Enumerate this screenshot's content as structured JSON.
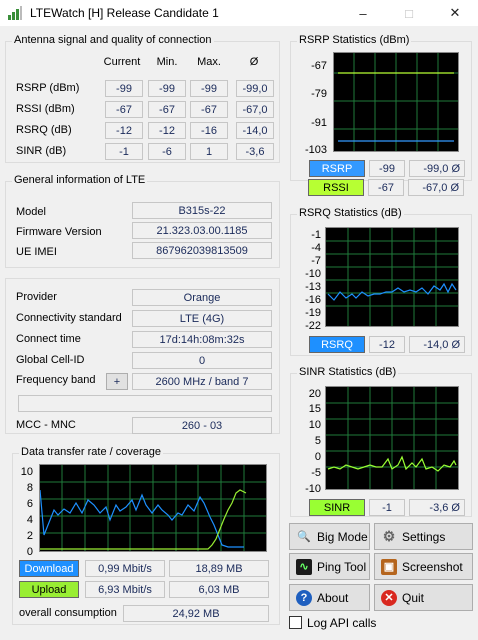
{
  "window": {
    "title": "LTEWatch [H]   Release Candidate 1"
  },
  "antenna": {
    "title": "Antenna signal and quality of connection",
    "headers": [
      "Current",
      "Min.",
      "Max.",
      "Ø"
    ],
    "rows": [
      {
        "label": "RSRP (dBm)",
        "values": [
          "-99",
          "-99",
          "-99",
          "-99,0"
        ]
      },
      {
        "label": "RSSI (dBm)",
        "values": [
          "-67",
          "-67",
          "-67",
          "-67,0"
        ]
      },
      {
        "label": "RSRQ (dB)",
        "values": [
          "-12",
          "-12",
          "-16",
          "-14,0"
        ]
      },
      {
        "label": "SINR (dB)",
        "values": [
          "-1",
          "-6",
          "1",
          "-3,6"
        ]
      }
    ]
  },
  "general": {
    "title": "General information of LTE",
    "model_label": "Model",
    "model": "B315s-22",
    "firmware_label": "Firmware Version",
    "firmware": "21.323.03.00.1185",
    "imei_label": "UE IMEI",
    "imei": "867962039813509"
  },
  "provider": {
    "provider_label": "Provider",
    "provider": "Orange",
    "standard_label": "Connectivity standard",
    "standard": "LTE (4G)",
    "connect_label": "Connect time",
    "connect": "17d:14h:08m:32s",
    "cell_label": "Global Cell-ID",
    "cell": "0",
    "band_label": "Frequency band",
    "band_button": "+",
    "band": "2600 MHz / band 7",
    "extra": "",
    "mccmnc_label": "MCC - MNC",
    "mccmnc": "260 - 03"
  },
  "transfer": {
    "title": "Data transfer rate / coverage",
    "yticks": [
      "10",
      "8",
      "6",
      "4",
      "2",
      "0"
    ],
    "download_label": "Download",
    "download_rate": "0,99 Mbit/s",
    "download_total": "18,89 MB",
    "upload_label": "Upload",
    "upload_rate": "6,93 Mbit/s",
    "upload_total": "6,03 MB",
    "overall_label": "overall consumption",
    "overall": "24,92 MB"
  },
  "rsrp_stats": {
    "title": "RSRP Statistics (dBm)",
    "yticks": [
      "-67",
      "-79",
      "-91",
      "-103"
    ],
    "legend1": "RSRP",
    "cur1": "-99",
    "avg1": "-99,0 Ø",
    "legend2": "RSSI",
    "cur2": "-67",
    "avg2": "-67,0 Ø"
  },
  "rsrq_stats": {
    "title": "RSRQ Statistics (dB)",
    "yticks": [
      "-1",
      "-4",
      "-7",
      "-10",
      "-13",
      "-16",
      "-19",
      "-22"
    ],
    "legend": "RSRQ",
    "cur": "-12",
    "avg": "-14,0 Ø"
  },
  "sinr_stats": {
    "title": "SINR Statistics (dB)",
    "yticks": [
      "20",
      "15",
      "10",
      "5",
      "0",
      "-5",
      "-10"
    ],
    "legend": "SINR",
    "cur": "-1",
    "avg": "-3,6 Ø"
  },
  "buttons": {
    "big_mode": "Big Mode",
    "settings": "Settings",
    "ping_tool": "Ping Tool",
    "screenshot": "Screenshot",
    "about": "About",
    "quit": "Quit"
  },
  "log_api": {
    "label": "Log API calls",
    "checked": false
  },
  "colors": {
    "rsrp": "#3399ff",
    "rssi": "#b7ff33",
    "rsrq": "#1e90ff",
    "sinr": "#99ff33",
    "download": "#1e90ff",
    "upload": "#99ee33",
    "plot_bg": "#000000",
    "grid": "#1f7a3a"
  }
}
